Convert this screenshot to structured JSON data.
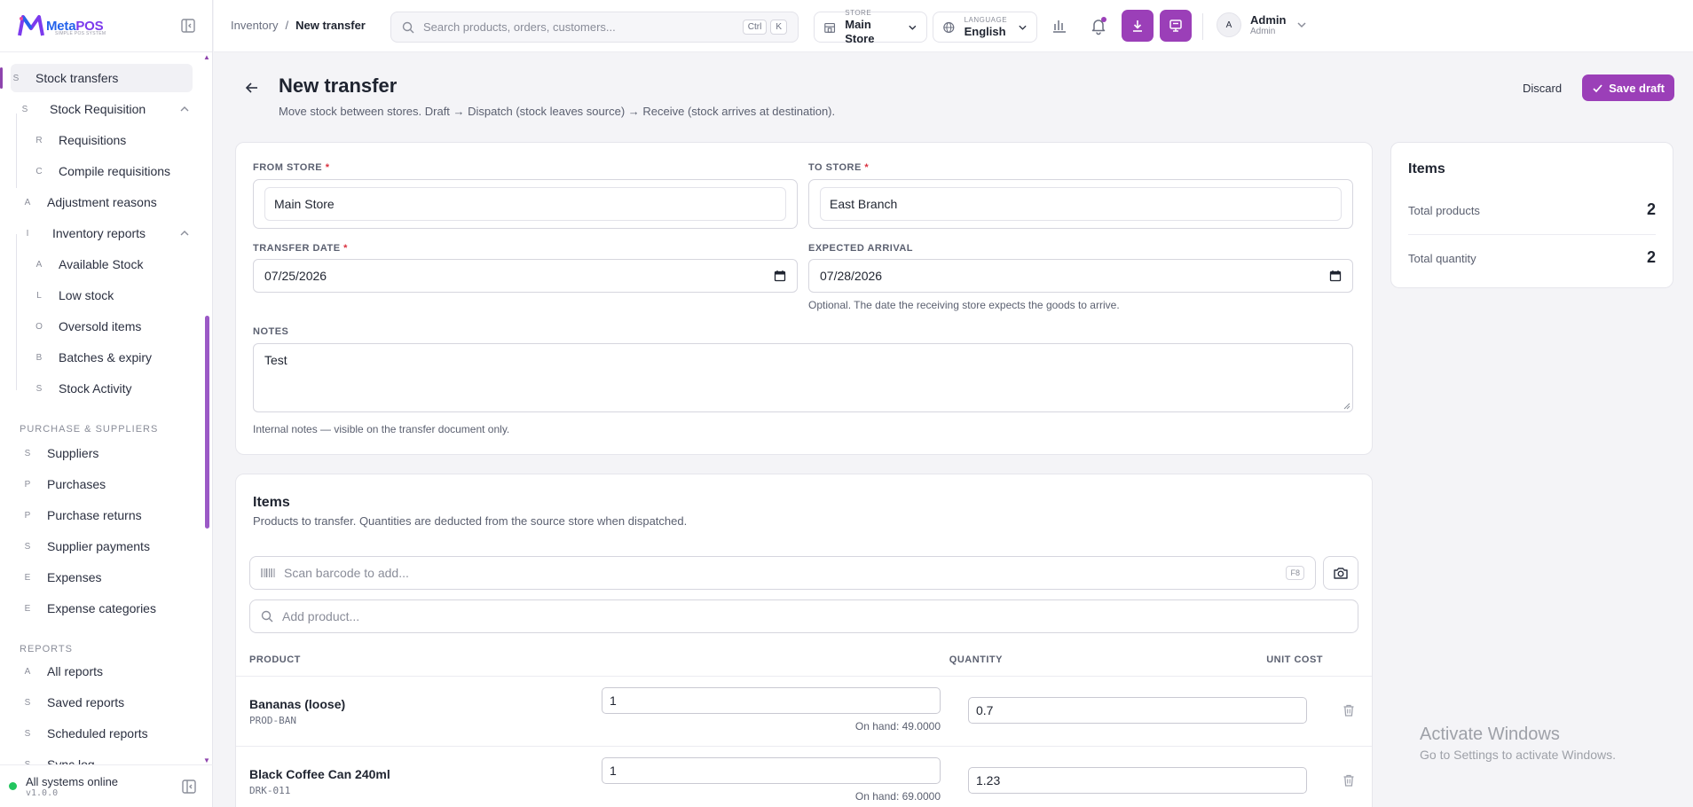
{
  "brand": {
    "name_part1": "Meta",
    "name_part2": "POS",
    "tagline": "SIMPLE POS SYSTEM",
    "accent": "#9b3fb8"
  },
  "sidebar": {
    "items": [
      {
        "letter": "S",
        "label": "Stock transfers",
        "active": true
      },
      {
        "letter": "S",
        "label": "Stock Requisition",
        "expanded": true
      },
      {
        "letter": "R",
        "label": "Requisitions"
      },
      {
        "letter": "C",
        "label": "Compile requisitions"
      },
      {
        "letter": "A",
        "label": "Adjustment reasons"
      },
      {
        "letter": "I",
        "label": "Inventory reports",
        "expanded": true
      },
      {
        "letter": "A",
        "label": "Available Stock"
      },
      {
        "letter": "L",
        "label": "Low stock"
      },
      {
        "letter": "O",
        "label": "Oversold items"
      },
      {
        "letter": "B",
        "label": "Batches & expiry"
      },
      {
        "letter": "S",
        "label": "Stock Activity"
      },
      {
        "letter": "S",
        "label": "Suppliers"
      },
      {
        "letter": "P",
        "label": "Purchases"
      },
      {
        "letter": "P",
        "label": "Purchase returns"
      },
      {
        "letter": "S",
        "label": "Supplier payments"
      },
      {
        "letter": "E",
        "label": "Expenses"
      },
      {
        "letter": "E",
        "label": "Expense categories"
      },
      {
        "letter": "A",
        "label": "All reports"
      },
      {
        "letter": "S",
        "label": "Saved reports"
      },
      {
        "letter": "S",
        "label": "Scheduled reports"
      },
      {
        "letter": "S",
        "label": "Sync log"
      }
    ],
    "sections": {
      "purchase": "PURCHASE & SUPPLIERS",
      "reports": "REPORTS"
    },
    "footer": {
      "status": "All systems online",
      "version": "v1.0.0",
      "status_color": "#22c55e"
    }
  },
  "topbar": {
    "breadcrumb": {
      "parent": "Inventory",
      "sep": "/",
      "current": "New transfer"
    },
    "search": {
      "placeholder": "Search products, orders, customers...",
      "kbd1": "Ctrl",
      "kbd2": "K"
    },
    "store": {
      "caption": "STORE",
      "value": "Main Store"
    },
    "language": {
      "caption": "LANGUAGE",
      "value": "English"
    },
    "user": {
      "initial": "A",
      "name": "Admin",
      "role": "Admin"
    }
  },
  "page": {
    "title": "New transfer",
    "subtitle": "Move stock between stores. Draft → Dispatch (stock leaves source) → Receive (stock arrives at destination).",
    "discard": "Discard",
    "save": "Save draft"
  },
  "form": {
    "from_label": "FROM STORE",
    "from_value": "Main Store",
    "to_label": "TO STORE",
    "to_value": "East Branch",
    "date_label": "TRANSFER DATE",
    "date_value": "07/25/2026",
    "arrival_label": "EXPECTED ARRIVAL",
    "arrival_value": "07/28/2026",
    "arrival_help": "Optional. The date the receiving store expects the goods to arrive.",
    "notes_label": "NOTES",
    "notes_value": "Test",
    "notes_help": "Internal notes — visible on the transfer document only.",
    "required": "*"
  },
  "items": {
    "title": "Items",
    "subtitle": "Products to transfer. Quantities are deducted from the source store when dispatched.",
    "scan_placeholder": "Scan barcode to add...",
    "scan_key": "F8",
    "add_placeholder": "Add product...",
    "columns": {
      "product": "PRODUCT",
      "quantity": "QUANTITY",
      "unit_cost": "UNIT COST"
    },
    "rows": [
      {
        "name": "Bananas (loose)",
        "sku": "PROD-BAN",
        "qty": "1",
        "on_hand": "On hand: 49.0000",
        "cost": "0.7"
      },
      {
        "name": "Black Coffee Can 240ml",
        "sku": "DRK-011",
        "qty": "1",
        "on_hand": "On hand: 69.0000",
        "cost": "1.23"
      }
    ]
  },
  "summary": {
    "title": "Items",
    "total_products_label": "Total products",
    "total_products": "2",
    "total_quantity_label": "Total quantity",
    "total_quantity": "2"
  },
  "watermark": {
    "line1": "Activate Windows",
    "line2": "Go to Settings to activate Windows."
  }
}
